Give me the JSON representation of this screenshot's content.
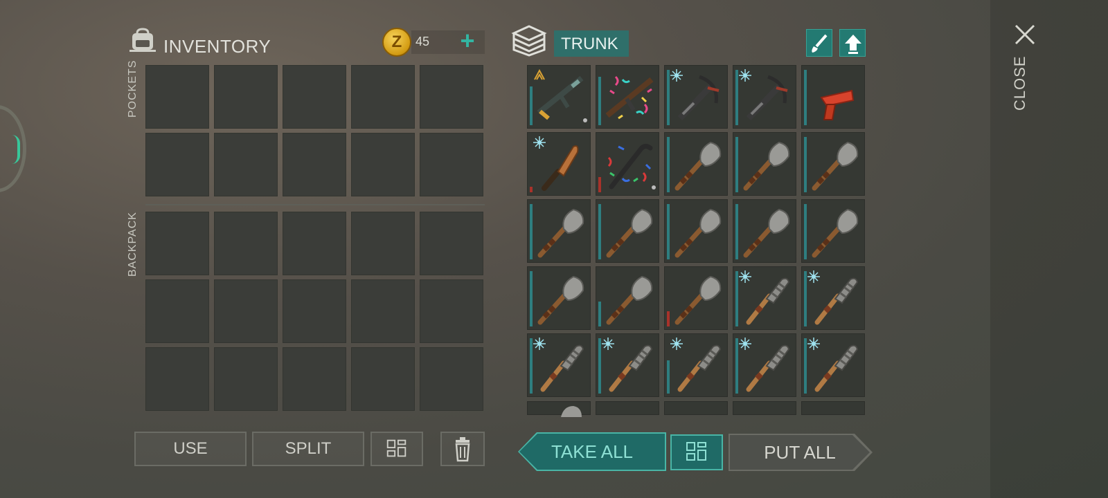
{
  "inventory": {
    "title": "INVENTORY",
    "pockets_label": "POCKETS",
    "backpack_label": "BACKPACK",
    "coin_symbol": "Z",
    "coin_count": "45",
    "add_icon": "plus-icon"
  },
  "trunk": {
    "title": "TRUNK",
    "paint_icon": "brush-icon",
    "upload_icon": "upload-arrow-icon",
    "items": [
      [
        "rifle",
        "ak-confetti",
        "crossbow",
        "crossbow",
        "flare-gun"
      ],
      [
        "machete",
        "crowbar-confetti",
        "shovel",
        "shovel",
        "shovel"
      ],
      [
        "shovel",
        "shovel",
        "shovel",
        "shovel",
        "shovel"
      ],
      [
        "shovel",
        "shovel",
        "shovel",
        "club",
        "club"
      ],
      [
        "club",
        "club",
        "club",
        "club",
        "club"
      ]
    ]
  },
  "close": {
    "label": "CLOSE",
    "icon": "close-icon"
  },
  "actions": {
    "use": "USE",
    "split": "SPLIT",
    "take_all": "TAKE ALL",
    "put_all": "PUT ALL",
    "sort_icon": "grid-sort-icon",
    "trash_icon": "trash-icon"
  },
  "colors": {
    "accent": "#2f7a73",
    "highlight": "#49b5a6",
    "coin": "#e3b52c"
  }
}
